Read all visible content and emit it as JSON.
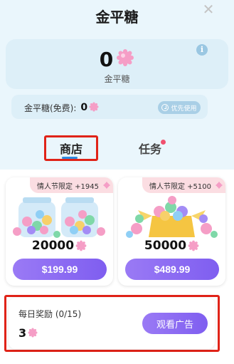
{
  "header": {
    "title": "金平糖",
    "close_icon": "close-icon"
  },
  "balance": {
    "value": "0",
    "label": "金平糖",
    "info_icon": "info-icon"
  },
  "free": {
    "label": "金平糖(免费):",
    "value": "0",
    "priority_label": "优先使用",
    "priority_icon": "clock-icon"
  },
  "tabs": [
    {
      "label": "商店",
      "active": true
    },
    {
      "label": "任务",
      "has_badge": true
    }
  ],
  "products": [
    {
      "promo": "情人节限定 +1945",
      "amount": "20000",
      "price": "$199.99",
      "art": "candy-jars"
    },
    {
      "promo": "情人节限定 +5100",
      "amount": "50000",
      "price": "$489.99",
      "art": "candy-box"
    }
  ],
  "daily": {
    "title": "每日奖励 (0/15)",
    "value": "3",
    "button": "观看广告"
  },
  "colors": {
    "accent": "#8a6cf2",
    "highlight_border": "#e02318",
    "panel_bg": "#eaf6fc",
    "promo_bg": "#fbdde2",
    "gem_pink": "#f59ec6"
  }
}
